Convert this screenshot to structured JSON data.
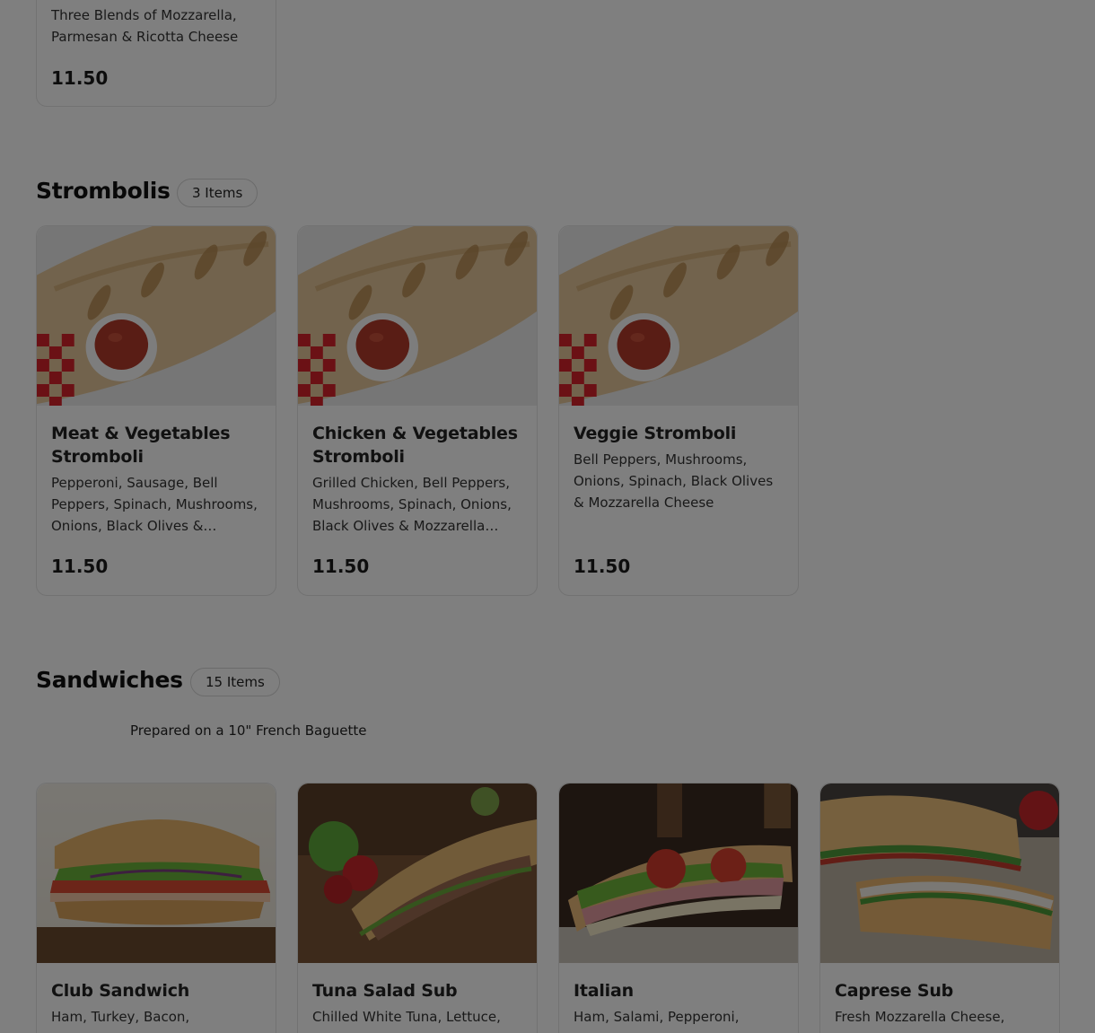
{
  "top_card": {
    "description": "Three Blends of Mozzarella, Parmesan & Ricotta Cheese",
    "price": "11.50"
  },
  "sections": {
    "strombolis": {
      "title": "Strombolis",
      "count": "3 Items",
      "items": [
        {
          "name": "Meat & Vegetables Stromboli",
          "description": "Pepperoni, Sausage, Bell Peppers, Spinach, Mushrooms, Onions, Black Olives & Mozzarella Cheese",
          "price": "11.50",
          "image_icon": "stromboli-photo"
        },
        {
          "name": "Chicken & Vegetables Stromboli",
          "description": "Grilled Chicken, Bell Peppers, Mushrooms, Spinach, Onions, Black Olives & Mozzarella Cheese",
          "price": "11.50",
          "image_icon": "stromboli-photo"
        },
        {
          "name": "Veggie Stromboli",
          "description": "Bell Peppers, Mushrooms, Onions, Spinach, Black Olives & Mozzarella Cheese",
          "price": "11.50",
          "image_icon": "stromboli-photo"
        }
      ]
    },
    "sandwiches": {
      "title": "Sandwiches",
      "count": "15 Items",
      "note": "Prepared on a 10\" French Baguette",
      "items": [
        {
          "name": "Club Sandwich",
          "description": "Ham, Turkey, Bacon,",
          "image_icon": "club-sandwich-photo"
        },
        {
          "name": "Tuna Salad Sub",
          "description": "Chilled White Tuna, Lettuce,",
          "image_icon": "tuna-sub-photo"
        },
        {
          "name": "Italian",
          "description": "Ham, Salami, Pepperoni,",
          "image_icon": "italian-sub-photo"
        },
        {
          "name": "Caprese Sub",
          "description": "Fresh Mozzarella Cheese,",
          "image_icon": "caprese-sub-photo"
        }
      ]
    }
  },
  "colors": {
    "overlay": "rgba(0,0,0,0.5)",
    "card_border": "#e4e4e4",
    "text": "#1a1a1a"
  }
}
